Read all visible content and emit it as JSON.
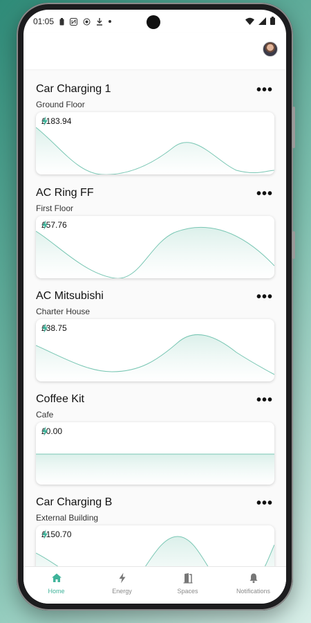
{
  "status_bar": {
    "time": "01:05",
    "left_icons": [
      "battery-saver-icon",
      "nfc-icon",
      "focus-icon",
      "download-icon",
      "dot-icon"
    ],
    "right_icons": [
      "wifi-icon",
      "signal-icon",
      "battery-icon"
    ]
  },
  "colors": {
    "accent": "#3fb39a",
    "line": "#78c6b3",
    "fill": "#d9efe9"
  },
  "cards": [
    {
      "title": "Car Charging 1",
      "subtitle": "Ground Floor",
      "cost": "£183.94"
    },
    {
      "title": "AC Ring FF",
      "subtitle": "First Floor",
      "cost": "£57.76"
    },
    {
      "title": "AC Mitsubishi",
      "subtitle": "Charter House",
      "cost": "£38.75"
    },
    {
      "title": "Coffee Kit",
      "subtitle": "Cafe",
      "cost": "£0.00"
    },
    {
      "title": "Car Charging B",
      "subtitle": "External Building",
      "cost": "£150.70"
    }
  ],
  "nav": [
    {
      "label": "Home",
      "icon": "home-icon",
      "active": true
    },
    {
      "label": "Energy",
      "icon": "bolt-icon",
      "active": false
    },
    {
      "label": "Spaces",
      "icon": "door-icon",
      "active": false
    },
    {
      "label": "Notifications",
      "icon": "bell-icon",
      "active": false
    }
  ]
}
